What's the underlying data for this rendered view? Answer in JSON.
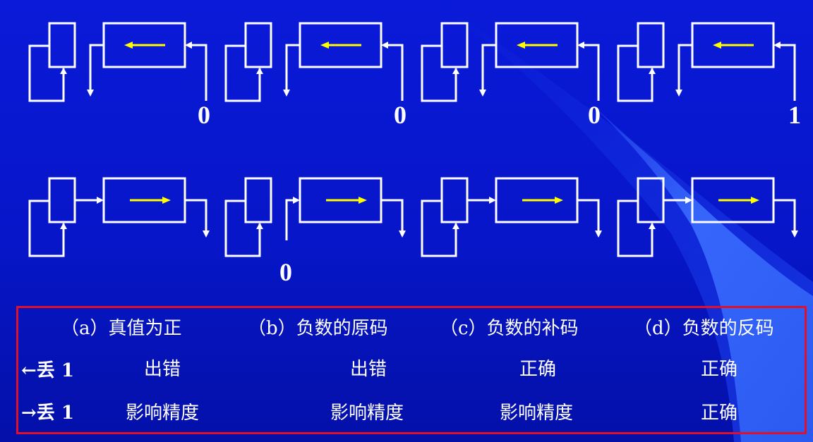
{
  "colors": {
    "background": "#0716c8",
    "stroke": "#ffffff",
    "shift_arrow": "#ffff00",
    "table_border": "#e0102a"
  },
  "diagram": {
    "top_row": {
      "shift_direction": "left",
      "bits": [
        "0",
        "0",
        "0",
        "1"
      ]
    },
    "bottom_row": {
      "shift_direction": "right",
      "bits": [
        "",
        "0",
        "",
        ""
      ]
    }
  },
  "table": {
    "headers": [
      "（a）真值为正",
      "（b）负数的原码",
      "（c）负数的补码",
      "（d）负数的反码"
    ],
    "rows": [
      {
        "label": "←丢 1",
        "cells": [
          "出错",
          "出错",
          "正确",
          "正确"
        ]
      },
      {
        "label": "→丢 1",
        "cells": [
          "影响精度",
          "影响精度",
          "影响精度",
          "正确"
        ]
      }
    ]
  }
}
